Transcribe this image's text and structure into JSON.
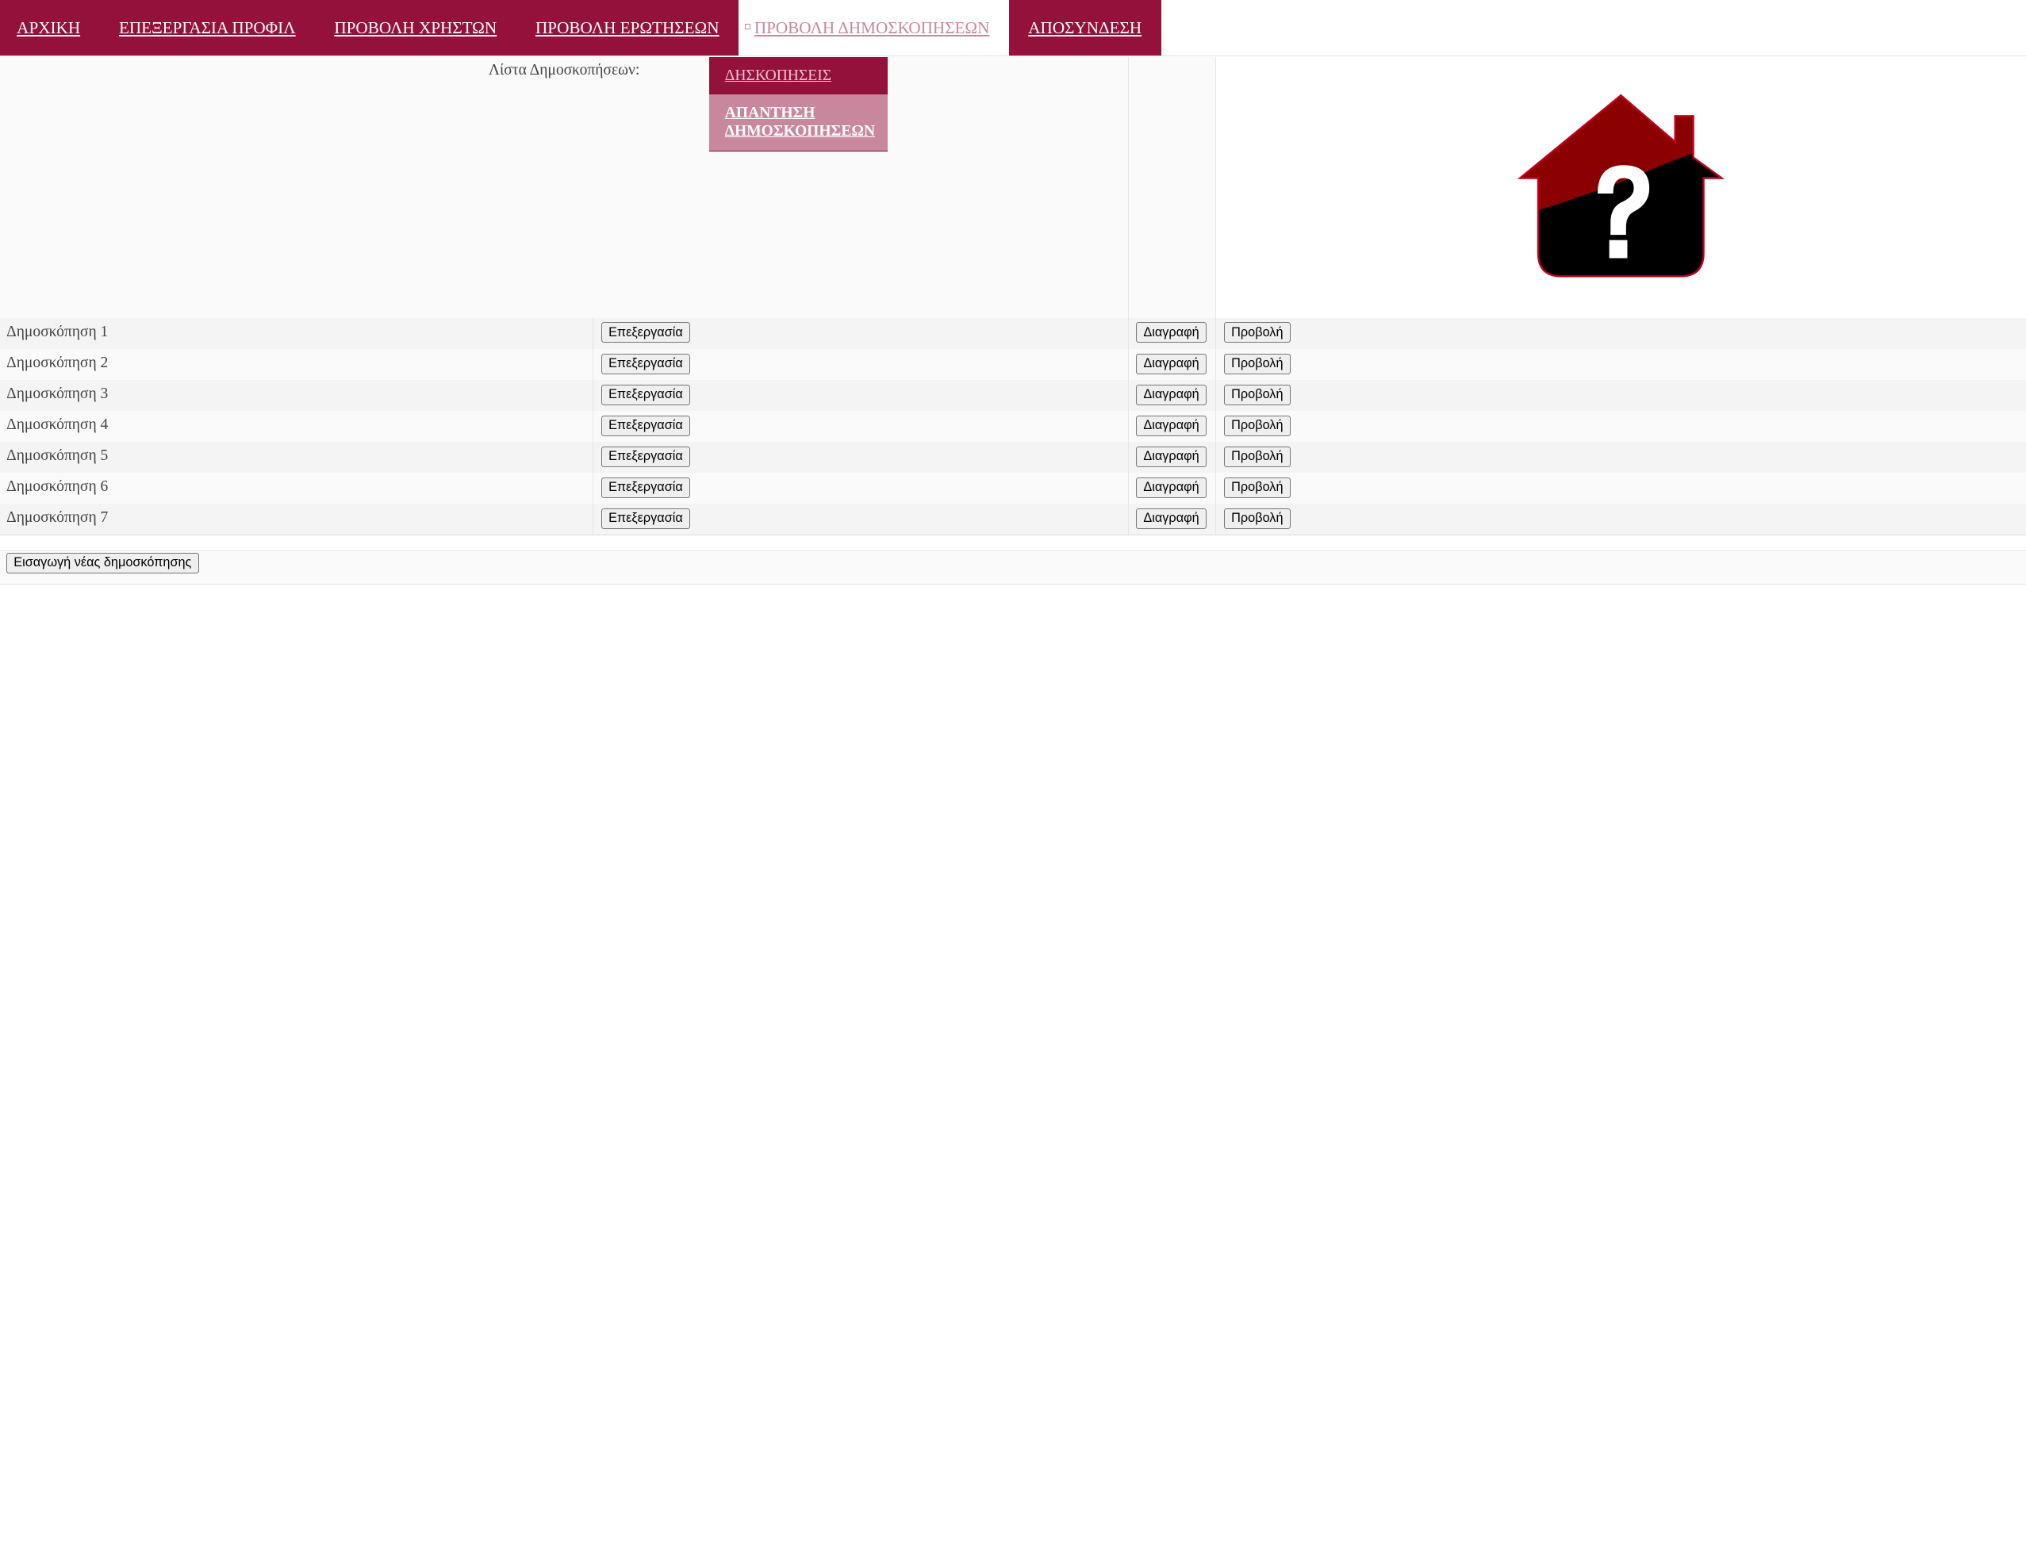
{
  "nav": {
    "items": [
      {
        "label": "ΑΡΧΙΚΗ"
      },
      {
        "label": "ΕΠΕΞΕΡΓΑΣΙΑ ΠΡΟΦΙΛ"
      },
      {
        "label": "ΠΡΟΒΟΛΗ ΧΡΗΣΤΩΝ"
      },
      {
        "label": "ΠΡΟΒΟΛΗ ΕΡΩΤΗΣΕΩΝ"
      },
      {
        "label": "ΠΡΟΒΟΛΗ ΔΗΜΟΣΚΟΠΗΣΕΩΝ"
      },
      {
        "label": "ΑΠΟΣΥΝΔΕΣΗ"
      }
    ],
    "active_index": 4
  },
  "dropdown": {
    "items": [
      {
        "label": "ΔΗΣΚΟΠΗΣΕΙΣ"
      },
      {
        "label": "ΑΠΑΝΤΗΣΗ ΔΗΜΟΣΚΟΠΗΣΕΩΝ"
      }
    ]
  },
  "list": {
    "title": "Λίστα Δημοσκοπήσεων:",
    "rows": [
      {
        "name": "Δημοσκόπηση 1"
      },
      {
        "name": "Δημοσκόπηση 2"
      },
      {
        "name": "Δημοσκόπηση 3"
      },
      {
        "name": "Δημοσκόπηση 4"
      },
      {
        "name": "Δημοσκόπηση 5"
      },
      {
        "name": "Δημοσκόπηση 6"
      },
      {
        "name": "Δημοσκόπηση 7"
      }
    ],
    "edit_label": "Επεξεργασία",
    "delete_label": "Διαγραφή",
    "view_label": "Προβολή"
  },
  "actions": {
    "add_label": "Εισαγωγή νέας δημοσκόπησης"
  },
  "colors": {
    "brand": "#94113b",
    "brand_light": "#c9879d",
    "logo_dark": "#8b0000",
    "logo_black": "#000000"
  },
  "logo": {
    "icon": "house-question-icon"
  }
}
